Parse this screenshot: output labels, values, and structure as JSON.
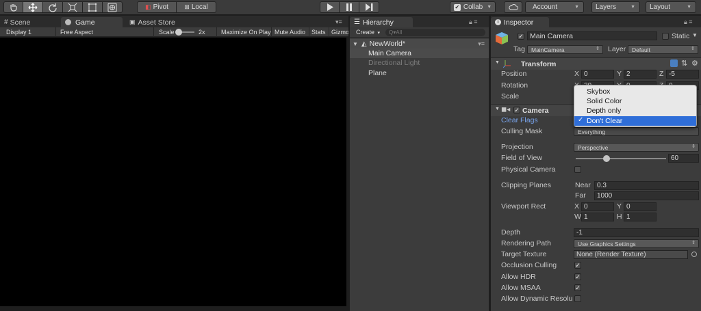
{
  "toolbar": {
    "tools": [
      "hand-tool",
      "move-tool",
      "rotate-tool",
      "scale-tool",
      "rect-tool",
      "transform-tool"
    ],
    "pivot_label": "Pivot",
    "local_label": "Local",
    "collab_label": "Collab",
    "account_label": "Account",
    "layers_label": "Layers",
    "layout_label": "Layout"
  },
  "left_tabs": {
    "scene": "Scene",
    "game": "Game",
    "asset_store": "Asset Store"
  },
  "game_bar": {
    "display": "Display 1",
    "aspect": "Free Aspect",
    "scale_label": "Scale",
    "scale_value": "2x",
    "maximize": "Maximize On Play",
    "mute": "Mute Audio",
    "stats": "Stats",
    "gizmos": "Gizmo"
  },
  "hierarchy": {
    "tab": "Hierarchy",
    "create": "Create",
    "search_placeholder": "Q▾All",
    "scene_name": "NewWorld*",
    "items": [
      {
        "label": "Main Camera",
        "selected": true,
        "dim": false
      },
      {
        "label": "Directional Light",
        "selected": false,
        "dim": true
      },
      {
        "label": "Plane",
        "selected": false,
        "dim": false
      }
    ]
  },
  "inspector": {
    "tab": "Inspector",
    "object_name": "Main Camera",
    "static_label": "Static",
    "tag_label": "Tag",
    "tag_value": "MainCamera",
    "layer_label": "Layer",
    "layer_value": "Default",
    "transform": {
      "title": "Transform",
      "position_label": "Position",
      "rotation_label": "Rotation",
      "scale_label": "Scale",
      "pos_x": "0",
      "pos_y": "2",
      "pos_z": "-5",
      "rot_x": "30",
      "rot_y": "0",
      "rot_z": "0"
    },
    "camera": {
      "title": "Camera",
      "clear_flags": "Clear Flags",
      "culling_mask": "Culling Mask",
      "culling_value": "Everything",
      "projection": "Projection",
      "projection_value": "Perspective",
      "fov": "Field of View",
      "fov_value": "60",
      "fov_fraction": 0.33,
      "physical": "Physical Camera",
      "clipping": "Clipping Planes",
      "near_label": "Near",
      "near_value": "0.3",
      "far_label": "Far",
      "far_value": "1000",
      "viewport": "Viewport Rect",
      "vp_x": "0",
      "vp_y": "0",
      "vp_w": "1",
      "vp_h": "1",
      "depth": "Depth",
      "depth_value": "-1",
      "rendering_path": "Rendering Path",
      "rendering_value": "Use Graphics Settings",
      "target_texture": "Target Texture",
      "target_value": "None (Render Texture)",
      "occlusion": "Occlusion Culling",
      "hdr": "Allow HDR",
      "msaa": "Allow MSAA",
      "dynres": "Allow Dynamic Resolu"
    }
  },
  "clear_flags_menu": {
    "options": [
      "Skybox",
      "Solid Color",
      "Depth only",
      "Don't Clear"
    ],
    "selected": "Don't Clear"
  },
  "colors": {
    "selection_blue": "#2f6ed8",
    "link_blue": "#7aa6f0"
  }
}
